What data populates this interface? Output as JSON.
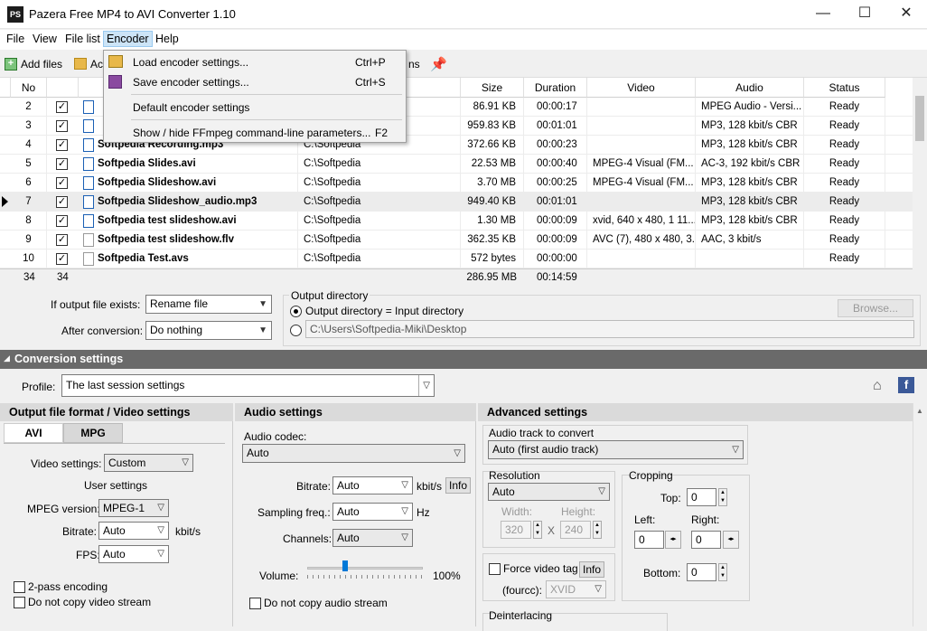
{
  "window": {
    "title": "Pazera Free MP4 to AVI Converter 1.10",
    "minimize": "—",
    "maximize": "☐",
    "close": "✕"
  },
  "menu": {
    "file": "File",
    "view": "View",
    "filelist": "File list",
    "encoder": "Encoder",
    "help": "Help"
  },
  "toolbar": {
    "add_files": "Add files",
    "add_trunc": "Ac",
    "right_trunc": "ns"
  },
  "dropdown": {
    "items": [
      {
        "label": "Load encoder settings...",
        "shortcut": "Ctrl+P"
      },
      {
        "label": "Save encoder settings...",
        "shortcut": "Ctrl+S"
      },
      {
        "label": "Default encoder settings",
        "shortcut": ""
      },
      {
        "label": "Show / hide FFmpeg command-line parameters...",
        "shortcut": "F2"
      }
    ]
  },
  "table": {
    "headers": {
      "no": "No",
      "size": "Size",
      "duration": "Duration",
      "video": "Video",
      "audio": "Audio",
      "status": "Status"
    },
    "rows": [
      {
        "no": "2",
        "name": "",
        "path": "",
        "size": "86.91 KB",
        "duration": "00:00:17",
        "video": "",
        "audio": "MPEG Audio - Versi...",
        "status": "Ready"
      },
      {
        "no": "3",
        "name": "",
        "path": "",
        "size": "959.83 KB",
        "duration": "00:01:01",
        "video": "",
        "audio": "MP3, 128 kbit/s  CBR",
        "status": "Ready"
      },
      {
        "no": "4",
        "name": "Softpedia Recording.mp3",
        "path": "C:\\Softpedia",
        "size": "372.66 KB",
        "duration": "00:00:23",
        "video": "",
        "audio": "MP3, 128 kbit/s  CBR",
        "status": "Ready"
      },
      {
        "no": "5",
        "name": "Softpedia Slides.avi",
        "path": "C:\\Softpedia",
        "size": "22.53 MB",
        "duration": "00:00:40",
        "video": "MPEG-4 Visual (FM...",
        "audio": "AC-3, 192 kbit/s  CBR",
        "status": "Ready"
      },
      {
        "no": "6",
        "name": "Softpedia Slideshow.avi",
        "path": "C:\\Softpedia",
        "size": "3.70 MB",
        "duration": "00:00:25",
        "video": "MPEG-4 Visual (FM...",
        "audio": "MP3, 128 kbit/s  CBR",
        "status": "Ready"
      },
      {
        "no": "7",
        "name": "Softpedia Slideshow_audio.mp3",
        "path": "C:\\Softpedia",
        "size": "949.40 KB",
        "duration": "00:01:01",
        "video": "",
        "audio": "MP3, 128 kbit/s  CBR",
        "status": "Ready"
      },
      {
        "no": "8",
        "name": "Softpedia test slideshow.avi",
        "path": "C:\\Softpedia",
        "size": "1.30 MB",
        "duration": "00:00:09",
        "video": "xvid, 640 x 480, 1 11...",
        "audio": "MP3, 128 kbit/s  CBR",
        "status": "Ready"
      },
      {
        "no": "9",
        "name": "Softpedia test slideshow.flv",
        "path": "C:\\Softpedia",
        "size": "362.35 KB",
        "duration": "00:00:09",
        "video": "AVC (7), 480 x 480, 3...",
        "audio": "AAC, 3 kbit/s",
        "status": "Ready"
      },
      {
        "no": "10",
        "name": "Softpedia Test.avs",
        "path": "C:\\Softpedia",
        "size": "572 bytes",
        "duration": "00:00:00",
        "video": "",
        "audio": "",
        "status": "Ready"
      }
    ],
    "summary": {
      "no": "34",
      "checked": "34",
      "size": "286.95 MB",
      "duration": "00:14:59"
    }
  },
  "output": {
    "if_exists_label": "If output file exists:",
    "if_exists_value": "Rename file",
    "after_label": "After conversion:",
    "after_value": "Do nothing",
    "dir_group": "Output directory",
    "radio_input": "Output directory = Input directory",
    "custom_path": "C:\\Users\\Softpedia-Miki\\Desktop",
    "browse": "Browse..."
  },
  "conversion": {
    "header": "Conversion settings",
    "profile_label": "Profile:",
    "profile_value": "The last session settings"
  },
  "video": {
    "header": "Output file format / Video settings",
    "tab_avi": "AVI",
    "tab_mpg": "MPG",
    "settings_label": "Video settings:",
    "settings_value": "Custom",
    "user_settings": "User settings",
    "mpeg_label": "MPEG version:",
    "mpeg_value": "MPEG-1",
    "bitrate_label": "Bitrate:",
    "bitrate_value": "Auto",
    "bitrate_unit": "kbit/s",
    "fps_label": "FPS:",
    "fps_value": "Auto",
    "two_pass": "2-pass encoding",
    "no_copy": "Do not copy video stream"
  },
  "audio": {
    "header": "Audio settings",
    "codec_label": "Audio codec:",
    "codec_value": "Auto",
    "bitrate_label": "Bitrate:",
    "bitrate_value": "Auto",
    "bitrate_unit": "kbit/s",
    "info": "Info",
    "sampling_label": "Sampling freq.:",
    "sampling_value": "Auto",
    "sampling_unit": "Hz",
    "channels_label": "Channels:",
    "channels_value": "Auto",
    "volume_label": "Volume:",
    "volume_value": "100%",
    "volume_level": 0.33,
    "no_copy": "Do not copy audio stream"
  },
  "advanced": {
    "header": "Advanced settings",
    "track_label": "Audio track to convert",
    "track_value": "Auto (first audio track)",
    "resolution_label": "Resolution",
    "resolution_value": "Auto",
    "width_label": "Width:",
    "height_label": "Height:",
    "width_value": "320",
    "height_value": "240",
    "x": "X",
    "cropping_label": "Cropping",
    "top_label": "Top:",
    "left_label": "Left:",
    "right_label": "Right:",
    "bottom_label": "Bottom:",
    "top_value": "0",
    "left_value": "0",
    "right_value": "0",
    "bottom_value": "0",
    "force_tag": "Force video tag",
    "info": "Info",
    "fourcc_label": "(fourcc):",
    "fourcc_value": "XVID",
    "deinterlacing": "Deinterlacing"
  }
}
